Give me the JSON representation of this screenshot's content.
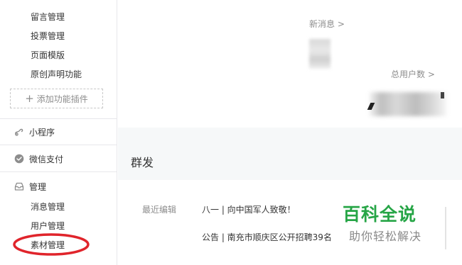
{
  "sidebar": {
    "function_items": [
      {
        "label": "留言管理"
      },
      {
        "label": "投票管理"
      },
      {
        "label": "页面模版"
      },
      {
        "label": "原创声明功能"
      }
    ],
    "add_plugin": {
      "label": "添加功能插件",
      "icon": "plus-icon"
    },
    "nav": [
      {
        "label": "小程序",
        "icon": "mini-program-icon"
      },
      {
        "label": "微信支付",
        "icon": "wechat-pay-icon"
      },
      {
        "label": "管理",
        "icon": "inbox-icon"
      }
    ],
    "management_items": [
      {
        "label": "消息管理"
      },
      {
        "label": "用户管理"
      },
      {
        "label": "素材管理"
      }
    ],
    "highlight_color": "#e0242b"
  },
  "overview": {
    "new_messages_label": "新消息 >",
    "total_users_label": "总用户数 >"
  },
  "broadcast": {
    "section_title": "群发",
    "recent_label": "最近编辑",
    "articles": [
      {
        "title": "八一 | 向中国军人致敬！"
      },
      {
        "title": "公告 | 南充市顺庆区公开招聘39名"
      }
    ]
  },
  "watermark": {
    "title": "百科全说",
    "subtitle": "助你轻松解决",
    "color": "#26a546"
  }
}
